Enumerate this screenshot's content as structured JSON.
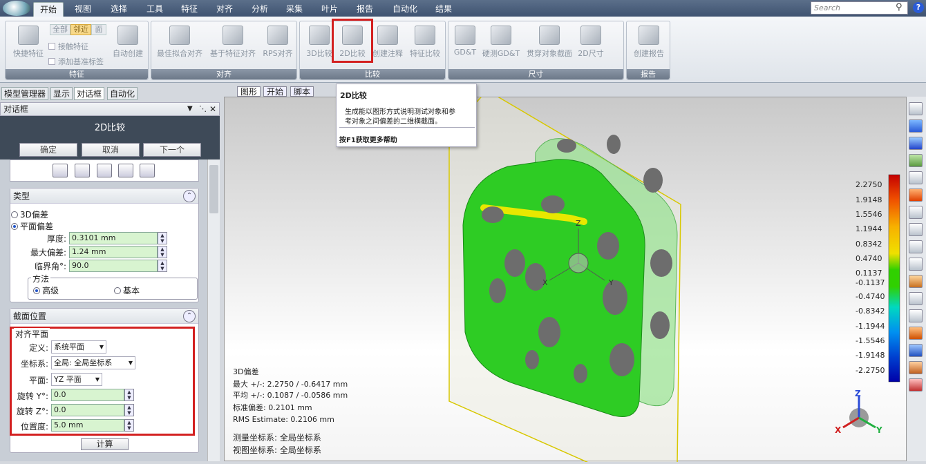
{
  "menu": {
    "items": [
      "开始",
      "视图",
      "选择",
      "工具",
      "特征",
      "对齐",
      "分析",
      "采集",
      "叶片",
      "报告",
      "自动化",
      "结果"
    ],
    "active": "开始",
    "search_placeholder": "Search"
  },
  "ribbon": {
    "feature_group": {
      "label": "特征",
      "quick_feature": "快捷特征",
      "filter_all": "全部",
      "filter_near": "邻近",
      "filter_face": "面",
      "touch_feature": "接触特征",
      "add_datum": "添加基准标签",
      "auto_create": "自动创建"
    },
    "align_group": {
      "label": "对齐",
      "best_fit": "最佳拟合对齐",
      "feature_align": "基于特征对齐",
      "rps_align": "RPS对齐"
    },
    "compare_group": {
      "label": "比较",
      "compare_3d": "3D比较",
      "compare_2d": "2D比较",
      "create_annotation": "创建注释",
      "feature_compare": "特征比较"
    },
    "dimension_group": {
      "label": "尺寸",
      "gdt": "GD&T",
      "probe_gdt": "硬测GD&T",
      "through_section": "贯穿对象截面",
      "dim_2d": "2D尺寸"
    },
    "report_group": {
      "label": "报告",
      "create_report": "创建报告"
    }
  },
  "left_tabs": [
    "模型管理器",
    "显示",
    "对话框",
    "自动化"
  ],
  "left_tabs_active": "对话框",
  "panel": {
    "header": "对话框",
    "dialog_title": "2D比较",
    "ok": "确定",
    "cancel": "取消",
    "next": "下一个",
    "type_section": {
      "title": "类型",
      "opt_3d": "3D偏差",
      "opt_plane": "平面偏差",
      "thickness_label": "厚度:",
      "thickness_value": "0.3101 mm",
      "max_dev_label": "最大偏差:",
      "max_dev_value": "1.24 mm",
      "critical_angle_label": "临界角°:",
      "critical_angle_value": "90.0",
      "method_label": "方法",
      "method_advanced": "高级",
      "method_basic": "基本"
    },
    "section_pos": {
      "title": "截面位置",
      "align_plane": "对齐平面",
      "define_label": "定义:",
      "define_value": "系统平面",
      "coord_label": "坐标系:",
      "coord_value": "全局: 全局坐标系",
      "plane_label": "平面:",
      "plane_value": "YZ 平面",
      "rot_y_label": "旋转 Y°:",
      "rot_y_value": "0.0",
      "rot_z_label": "旋转 Z°:",
      "rot_z_value": "0.0",
      "position_label": "位置度:",
      "position_value": "5.0 mm",
      "calc": "计算"
    }
  },
  "view_tabs": [
    "图形",
    "开始",
    "脚本"
  ],
  "view_tabs_active": "图形",
  "tooltip": {
    "title": "2D比较",
    "body_line1": "生成能以图形方式说明测试对象和参",
    "body_line2": "考对象之间偏差的二维横截面。",
    "help": "按F1获取更多帮助"
  },
  "color_scale": {
    "values": [
      "2.2750",
      "1.9148",
      "1.5546",
      "1.1944",
      "0.8342",
      "0.4740",
      "0.1137",
      "-0.1137",
      "-0.4740",
      "-0.8342",
      "-1.1944",
      "-1.5546",
      "-1.9148",
      "-2.2750"
    ],
    "colors": [
      "#c40000",
      "#e02000",
      "#f05000",
      "#f57f00",
      "#f7b000",
      "#f0e000",
      "#30d000",
      "#30d000",
      "#00d8c0",
      "#00b8e8",
      "#0090f0",
      "#0060e0",
      "#0030c8",
      "#0000a8"
    ]
  },
  "stats": {
    "title": "3D偏差",
    "max": "最大 +/-: 2.2750 / -0.6417 mm",
    "avg": "平均 +/-: 0.1087 / -0.0586 mm",
    "std": "标准偏差: 0.2101 mm",
    "rms": "RMS Estimate: 0.2106 mm",
    "measure_cs": "测量坐标系: 全局坐标系",
    "view_cs": "视图坐标系: 全局坐标系"
  },
  "axes": {
    "x": "X",
    "y": "Y",
    "z": "Z"
  }
}
